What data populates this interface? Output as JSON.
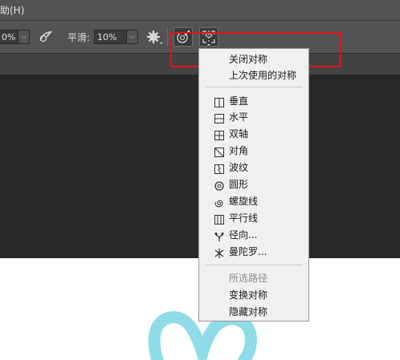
{
  "menubar": {
    "help_label": "助(H)"
  },
  "toolbar": {
    "opacity_value": "0%",
    "smoothing_label": "平滑:",
    "smoothing_value": "10%"
  },
  "menu": {
    "items": [
      {
        "label": "关闭对称"
      },
      {
        "label": "上次使用的对称"
      },
      {
        "label": "垂直",
        "icon": "vertical-icon"
      },
      {
        "label": "水平",
        "icon": "horizontal-icon"
      },
      {
        "label": "双轴",
        "icon": "dual-axis-icon"
      },
      {
        "label": "对角",
        "icon": "diagonal-icon"
      },
      {
        "label": "波纹",
        "icon": "wavy-icon"
      },
      {
        "label": "圆形",
        "icon": "circle-icon"
      },
      {
        "label": "螺旋线",
        "icon": "spiral-icon"
      },
      {
        "label": "平行线",
        "icon": "parallel-lines-icon"
      },
      {
        "label": "径向...",
        "icon": "radial-icon"
      },
      {
        "label": "曼陀罗...",
        "icon": "mandala-icon"
      },
      {
        "label": "所选路径",
        "disabled": true
      },
      {
        "label": "变换对称"
      },
      {
        "label": "隐藏对称"
      }
    ]
  },
  "colors": {
    "highlight": "#e0141b",
    "stroke_cyan": "#8fdbe8"
  }
}
